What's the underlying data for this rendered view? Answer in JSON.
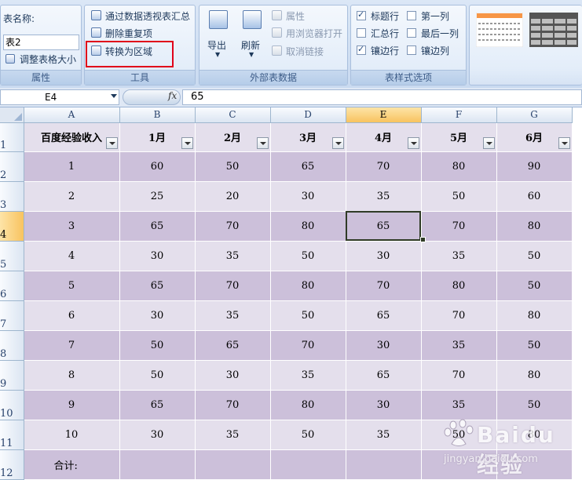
{
  "ribbon": {
    "properties": {
      "table_name_label": "表名称:",
      "table_name_value": "表2",
      "resize_table": "调整表格大小",
      "group_label": "属性"
    },
    "tools": {
      "summarize_pivot": "通过数据透视表汇总",
      "remove_duplicates": "删除重复项",
      "convert_to_range": "转换为区域",
      "group_label": "工具"
    },
    "external": {
      "export": "导出",
      "refresh": "刷新",
      "properties": "属性",
      "open_in_browser": "用浏览器打开",
      "unlink": "取消链接",
      "group_label": "外部表数据"
    },
    "style_options": {
      "header_row": "标题行",
      "first_column": "第一列",
      "total_row": "汇总行",
      "last_column": "最后一列",
      "banded_rows": "镶边行",
      "banded_columns": "镶边列",
      "group_label": "表样式选项"
    }
  },
  "formula_bar": {
    "name_box": "E4",
    "fx": "fx",
    "value": "65"
  },
  "sheet": {
    "columns": [
      "A",
      "B",
      "C",
      "D",
      "E",
      "F",
      "G"
    ],
    "selected_column": "E",
    "selected_row": "4",
    "header_row": [
      "百度经验收入",
      "1月",
      "2月",
      "3月",
      "4月",
      "5月",
      "6月"
    ],
    "rows": [
      {
        "num": "2",
        "cells": [
          "1",
          "60",
          "50",
          "65",
          "70",
          "80",
          "90"
        ]
      },
      {
        "num": "3",
        "cells": [
          "2",
          "25",
          "20",
          "30",
          "35",
          "50",
          "60"
        ]
      },
      {
        "num": "4",
        "cells": [
          "3",
          "65",
          "70",
          "80",
          "65",
          "70",
          "80"
        ]
      },
      {
        "num": "5",
        "cells": [
          "4",
          "30",
          "35",
          "50",
          "30",
          "35",
          "50"
        ]
      },
      {
        "num": "6",
        "cells": [
          "5",
          "65",
          "70",
          "80",
          "70",
          "80",
          "50"
        ]
      },
      {
        "num": "7",
        "cells": [
          "6",
          "30",
          "35",
          "50",
          "65",
          "70",
          "80"
        ]
      },
      {
        "num": "8",
        "cells": [
          "7",
          "50",
          "65",
          "70",
          "30",
          "35",
          "50"
        ]
      },
      {
        "num": "9",
        "cells": [
          "8",
          "50",
          "30",
          "35",
          "65",
          "70",
          "80"
        ]
      },
      {
        "num": "10",
        "cells": [
          "9",
          "65",
          "70",
          "80",
          "30",
          "35",
          "50"
        ]
      },
      {
        "num": "11",
        "cells": [
          "10",
          "30",
          "35",
          "50",
          "35",
          "50",
          "80"
        ]
      },
      {
        "num": "12",
        "cells": [
          "合计:",
          "",
          "",
          "",
          "",
          "",
          ""
        ]
      }
    ],
    "header_row_num": "1"
  },
  "watermark": {
    "brand": "Baidu 经验",
    "url": "jingyan.baidu.com"
  },
  "colors": {
    "band_dark": "#ccc0da",
    "band_light": "#e4dfec",
    "highlight_box": "#e0001a"
  }
}
